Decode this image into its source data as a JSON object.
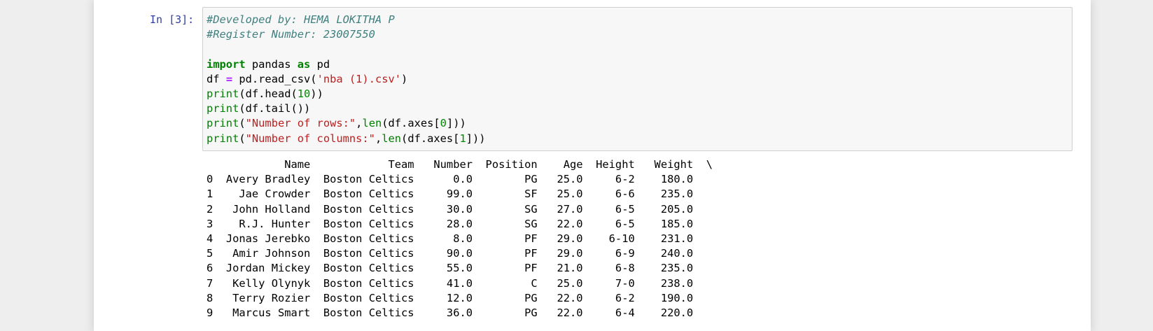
{
  "cell": {
    "prompt": "In [3]:",
    "code_lines": [
      [
        {
          "t": "#Developed by: HEMA LOKITHA P",
          "c": "comment"
        }
      ],
      [
        {
          "t": "#Register Number: 23007550",
          "c": "comment"
        }
      ],
      [],
      [
        {
          "t": "import",
          "c": "keyword"
        },
        {
          "t": " pandas "
        },
        {
          "t": "as",
          "c": "keyword"
        },
        {
          "t": " pd"
        }
      ],
      [
        {
          "t": "df "
        },
        {
          "t": "=",
          "c": "operator"
        },
        {
          "t": " pd.read_csv("
        },
        {
          "t": "'nba (1).csv'",
          "c": "string"
        },
        {
          "t": ")"
        }
      ],
      [
        {
          "t": "print",
          "c": "builtin"
        },
        {
          "t": "(df.head("
        },
        {
          "t": "10",
          "c": "number"
        },
        {
          "t": "))"
        }
      ],
      [
        {
          "t": "print",
          "c": "builtin"
        },
        {
          "t": "(df.tail())"
        }
      ],
      [
        {
          "t": "print",
          "c": "builtin"
        },
        {
          "t": "("
        },
        {
          "t": "\"Number of rows:\"",
          "c": "string"
        },
        {
          "t": ","
        },
        {
          "t": "len",
          "c": "builtin"
        },
        {
          "t": "(df.axes["
        },
        {
          "t": "0",
          "c": "number"
        },
        {
          "t": "]))"
        }
      ],
      [
        {
          "t": "print",
          "c": "builtin"
        },
        {
          "t": "("
        },
        {
          "t": "\"Number of columns:\"",
          "c": "string"
        },
        {
          "t": ","
        },
        {
          "t": "len",
          "c": "builtin"
        },
        {
          "t": "(df.axes["
        },
        {
          "t": "1",
          "c": "number"
        },
        {
          "t": "]))"
        }
      ]
    ]
  },
  "output": {
    "columns": [
      "Name",
      "Team",
      "Number",
      "Position",
      "Age",
      "Height",
      "Weight"
    ],
    "continuation": "\\",
    "rows": [
      [
        "0",
        "Avery Bradley",
        "Boston Celtics",
        "0.0",
        "PG",
        "25.0",
        "6-2",
        "180.0"
      ],
      [
        "1",
        "Jae Crowder",
        "Boston Celtics",
        "99.0",
        "SF",
        "25.0",
        "6-6",
        "235.0"
      ],
      [
        "2",
        "John Holland",
        "Boston Celtics",
        "30.0",
        "SG",
        "27.0",
        "6-5",
        "205.0"
      ],
      [
        "3",
        "R.J. Hunter",
        "Boston Celtics",
        "28.0",
        "SG",
        "22.0",
        "6-5",
        "185.0"
      ],
      [
        "4",
        "Jonas Jerebko",
        "Boston Celtics",
        "8.0",
        "PF",
        "29.0",
        "6-10",
        "231.0"
      ],
      [
        "5",
        "Amir Johnson",
        "Boston Celtics",
        "90.0",
        "PF",
        "29.0",
        "6-9",
        "240.0"
      ],
      [
        "6",
        "Jordan Mickey",
        "Boston Celtics",
        "55.0",
        "PF",
        "21.0",
        "6-8",
        "235.0"
      ],
      [
        "7",
        "Kelly Olynyk",
        "Boston Celtics",
        "41.0",
        "C",
        "25.0",
        "7-0",
        "238.0"
      ],
      [
        "8",
        "Terry Rozier",
        "Boston Celtics",
        "12.0",
        "PG",
        "22.0",
        "6-2",
        "190.0"
      ],
      [
        "9",
        "Marcus Smart",
        "Boston Celtics",
        "36.0",
        "PG",
        "22.0",
        "6-4",
        "220.0"
      ]
    ]
  }
}
